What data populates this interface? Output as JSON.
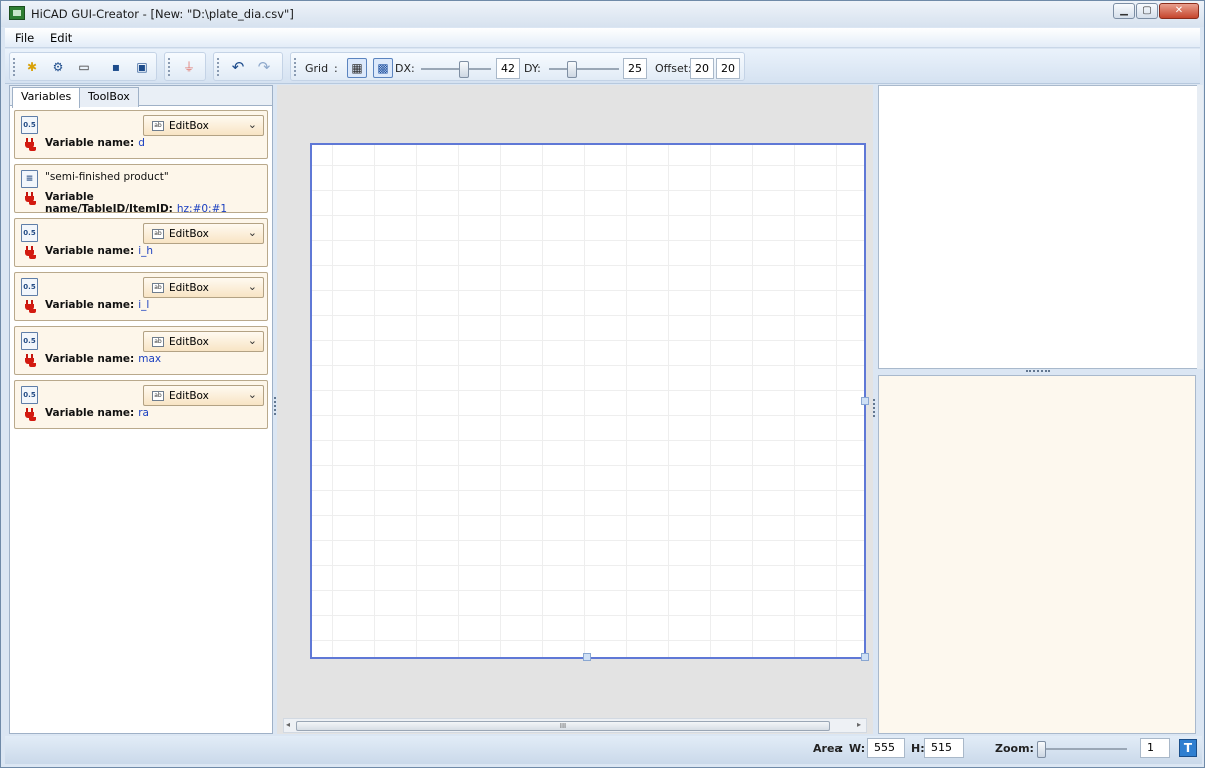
{
  "window": {
    "title": "HiCAD GUI-Creator - [New: \"D:\\plate_dia.csv\"]"
  },
  "menu": {
    "items": [
      "File",
      "Edit"
    ]
  },
  "toolbar": {
    "grid_label": "Grid",
    "grid_colon": ":",
    "dx_label": "DX:",
    "dx_value": "42",
    "dy_label": "DY:",
    "dy_value": "25",
    "offset_label": "Offset:",
    "offset_x": "20",
    "offset_y": "20"
  },
  "tabs": [
    "Variables",
    "ToolBox"
  ],
  "variables": [
    {
      "icon": "0.5",
      "label": "Variable name:",
      "value": "d",
      "control": "EditBox"
    },
    {
      "quote": "\"semi-finished product\"",
      "label": "Variable name/TableID/ItemID:",
      "value": "hz:#0:#1"
    },
    {
      "icon": "0.5",
      "label": "Variable name:",
      "value": "i_h",
      "control": "EditBox"
    },
    {
      "icon": "0.5",
      "label": "Variable name:",
      "value": "i_l",
      "control": "EditBox"
    },
    {
      "icon": "0.5",
      "label": "Variable name:",
      "value": "max",
      "control": "EditBox"
    },
    {
      "icon": "0.5",
      "label": "Variable name:",
      "value": "ra",
      "control": "EditBox"
    }
  ],
  "status": {
    "area_label": "Area",
    "area_colon": ":",
    "w_label": "W:",
    "w_value": "555",
    "h_label": "H:",
    "h_value": "515",
    "zoom_label": "Zoom:",
    "zoom_value": "1",
    "t_button": "T"
  },
  "scroll": {
    "thumb_glyph": "III"
  }
}
